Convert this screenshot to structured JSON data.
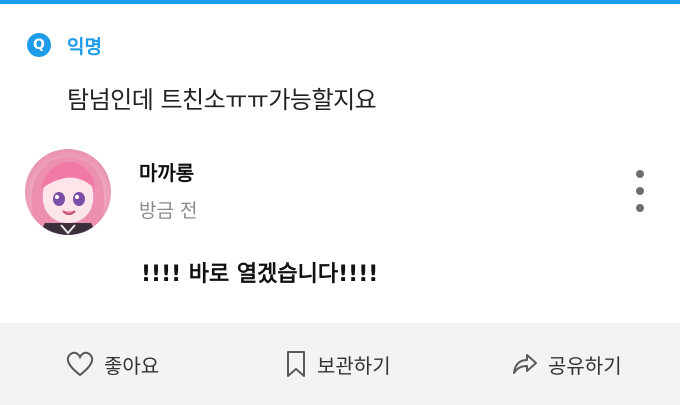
{
  "colors": {
    "accent": "#1e9be9"
  },
  "post": {
    "badge_letter": "Q",
    "anonymous_label": "익명",
    "question": "탐넘인데 트친소ㅠㅠ가능할지요"
  },
  "answer": {
    "author": "마까롱",
    "timestamp": "방금 전",
    "text": "!!!! 바로 열겠습니다!!!!"
  },
  "actions": {
    "like": {
      "label": "좋아요",
      "icon": "heart-icon"
    },
    "save": {
      "label": "보관하기",
      "icon": "bookmark-icon"
    },
    "share": {
      "label": "공유하기",
      "icon": "share-icon"
    }
  }
}
